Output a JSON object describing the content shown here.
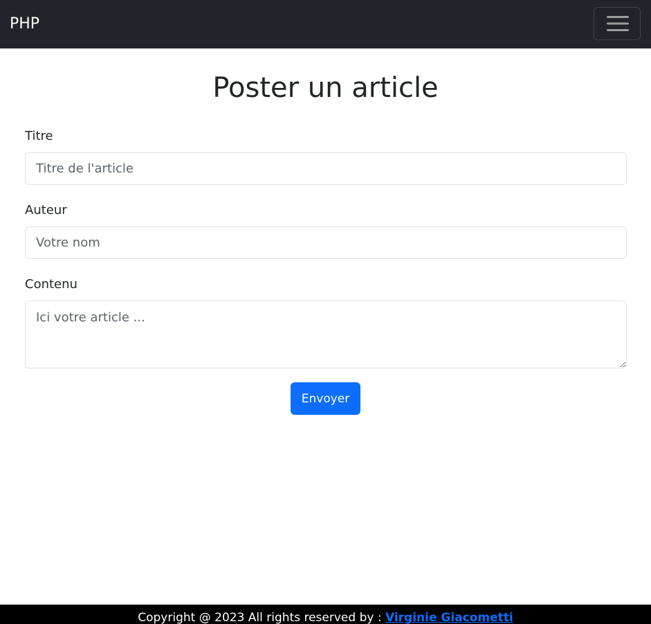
{
  "navbar": {
    "brand": "PHP",
    "toggler_icon": "hamburger-menu-icon"
  },
  "page": {
    "title": "Poster un article"
  },
  "form": {
    "title_label": "Titre",
    "title_placeholder": "Titre de l'article",
    "title_value": "",
    "author_label": "Auteur",
    "author_placeholder": "Votre nom",
    "author_value": "",
    "content_label": "Contenu",
    "content_placeholder": "Ici votre article ...",
    "content_value": "",
    "submit_label": "Envoyer"
  },
  "footer": {
    "text": "Copyright @ 2023 All rights reserved by : ",
    "author_link": "Virginie Giacometti"
  },
  "colors": {
    "navbar_bg": "#212529",
    "primary": "#0d6efd",
    "footer_bg": "#000000",
    "link": "#0d6efd"
  }
}
